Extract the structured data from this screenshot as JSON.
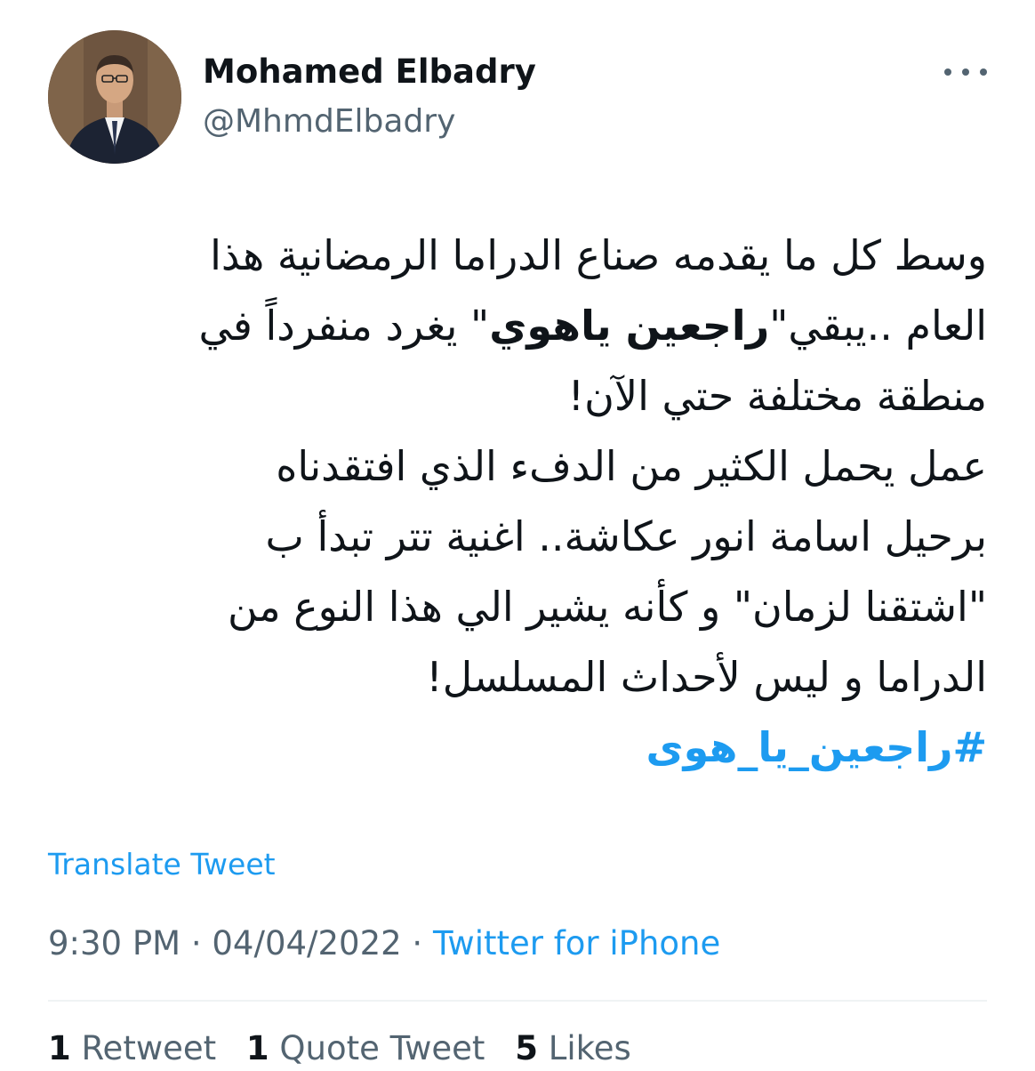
{
  "user": {
    "display_name": "Mohamed Elbadry",
    "handle": "@MhmdElbadry",
    "avatar_icon": "profile-photo"
  },
  "more_icon": "more-horizontal-icon",
  "tweet": {
    "line1": "وسط كل ما يقدمه صناع الدراما الرمضانية هذا",
    "line2_start": "العام ..يبقي\"",
    "line2_bold": "راجعين ياهوي",
    "line2_end": "\" يغرد منفرداً في",
    "line3": "منطقة مختلفة حتي الآن!",
    "line4": "عمل يحمل الكثير من الدفء الذي افتقدناه",
    "line5": "برحيل اسامة انور عكاشة.. اغنية تتر تبدأ ب",
    "line6": "\"اشتقنا لزمان\" و كأنه يشير الي هذا النوع من",
    "line7": "الدراما و ليس لأحداث المسلسل!",
    "hashtag": "#راجعين_يا_هوى"
  },
  "translate_label": "Translate Tweet",
  "meta": {
    "time": "9:30 PM",
    "separator": " · ",
    "date": "04/04/2022",
    "source": "Twitter for iPhone"
  },
  "stats": {
    "retweets_count": "1",
    "retweets_label": "Retweet",
    "quotes_count": "1",
    "quotes_label": "Quote Tweet",
    "likes_count": "5",
    "likes_label": "Likes"
  },
  "colors": {
    "accent": "#1d9bf0",
    "text": "#0f1419",
    "secondary": "#536471"
  }
}
